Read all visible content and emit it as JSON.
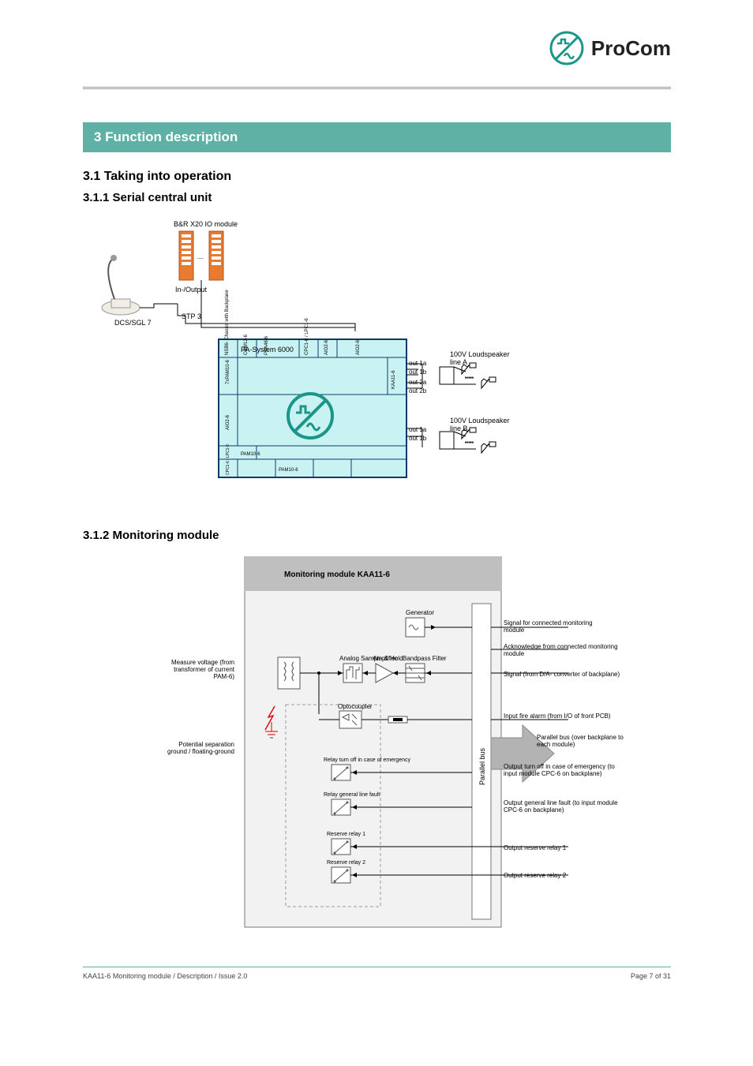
{
  "brand": "ProCom",
  "section_heading": "3  Function description",
  "subheading1": "3.1  Taking into operation",
  "subheading2": "3.1.1  Serial central unit",
  "subheading3": "3.1.2  Monitoring module",
  "diagram1": {
    "title": "PA-System 6000",
    "center_text": "ProCom",
    "mic_label": "DCS/SGL 7",
    "iom_label": "B&R X20 IO module",
    "io_label": "In-/Output",
    "stp3_label": "STP 3",
    "line_labels": {
      "A": "100V Loudspeaker line A",
      "B": "100V Loudspeaker line B"
    },
    "slots": [
      "NSB6- Chassis with Backplane",
      "CSW12-6",
      "PSA48-6",
      "CPC1-6 / LPC1-6",
      "AIO2-6",
      "AIO2-6",
      "7xPAM10-6",
      "AIO2-6",
      "PAM10-6",
      "CPC1-6 / LPC1-6",
      "PAM10-6",
      "KAA11-6"
    ],
    "outputs": [
      "out 1a",
      "out 1b",
      "out 2a",
      "out 2b",
      "out 1a",
      "out 1b"
    ]
  },
  "diagram2": {
    "title": "Monitoring module KAA11-6",
    "board_label": "Monitoring module KAA11-6",
    "module_labels": {
      "gen": "Generator",
      "amp": "Amplifier",
      "filter": "Bandpass Filter",
      "sh": "Analog Sample & Hold",
      "opto": "Optocoupler",
      "relay1": "Relay turn off in case of emergency",
      "relay2": "Relay general line fault",
      "relay3": "Reserve relay 1",
      "relay4": "Reserve relay 2",
      "bus": "Parallel bus"
    },
    "labels_right": {
      "signal_mon": "Signal for connected monitoring module",
      "ack_mon": "Acknowledge from connected monitoring module",
      "da": "Signal (from D/A- converter of backplane)",
      "fire_in": "Input fire alarm (from I/O of front PCB)",
      "turnoff": "Output turn off in case of emergency (to input module CPC-6 on backplane)",
      "linefault": "Output general line fault (to input module CPC-6 on backplane)",
      "res1": "Output reserve relay 1",
      "res2": "Output reserve relay 2",
      "bus_note": "Parallel bus (over backplane to each module)"
    },
    "labels_left": {
      "voltage": "Measure voltage (from transformer of current PAM-6)",
      "pot_sep": "Potential separation ground / floating-ground"
    }
  },
  "footer": {
    "left": "KAA11-6 Monitoring module / Description /  Issue 2.0",
    "right": "Page 7 of 31"
  }
}
